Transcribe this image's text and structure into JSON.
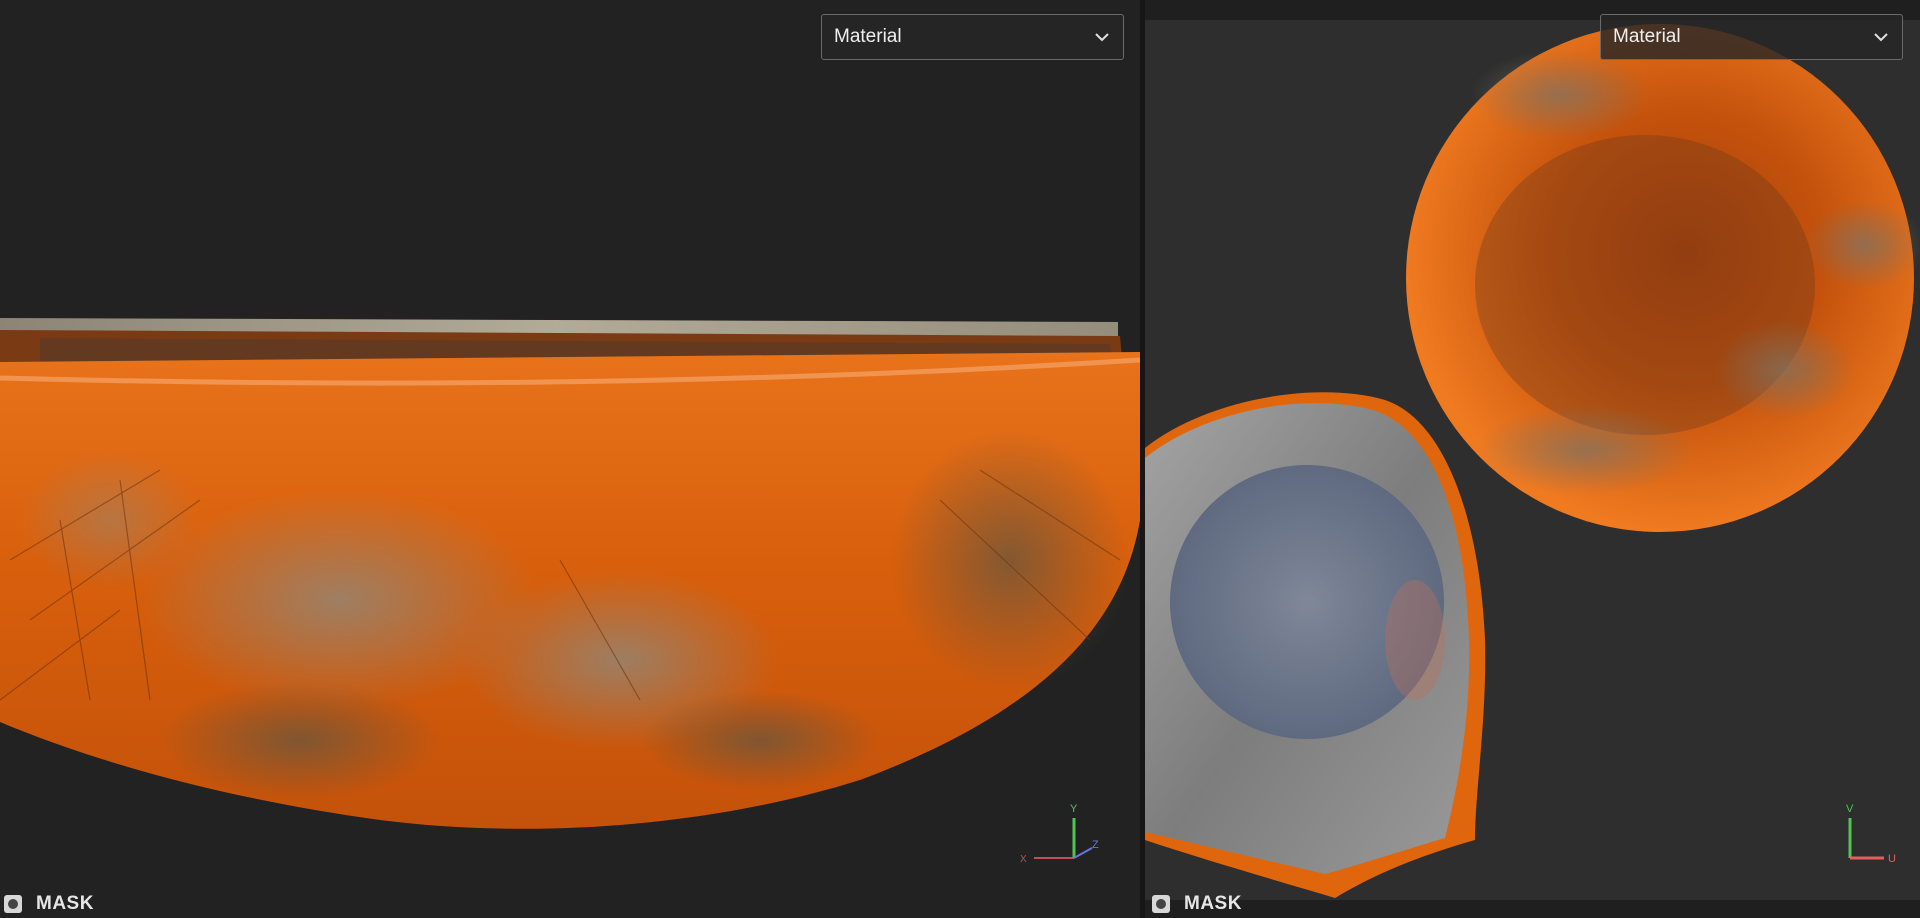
{
  "viewport_3d": {
    "channel_dropdown": {
      "selected": "Material"
    },
    "mask": {
      "label": "MASK"
    },
    "axis_gizmo": {
      "x_label": "X",
      "y_label": "Y",
      "z_label": "Z"
    }
  },
  "viewport_uv": {
    "channel_dropdown": {
      "selected": "Material"
    },
    "mask": {
      "label": "MASK"
    },
    "axis_gizmo": {
      "u_label": "U",
      "v_label": "V"
    }
  },
  "colors": {
    "paint_orange": "#d9620c",
    "metal_gray": "#8d8d8d",
    "inner_blue_gray": "#6b7688",
    "axis_x": "#e06060",
    "axis_y": "#52c452",
    "axis_z": "#6a74e0"
  }
}
